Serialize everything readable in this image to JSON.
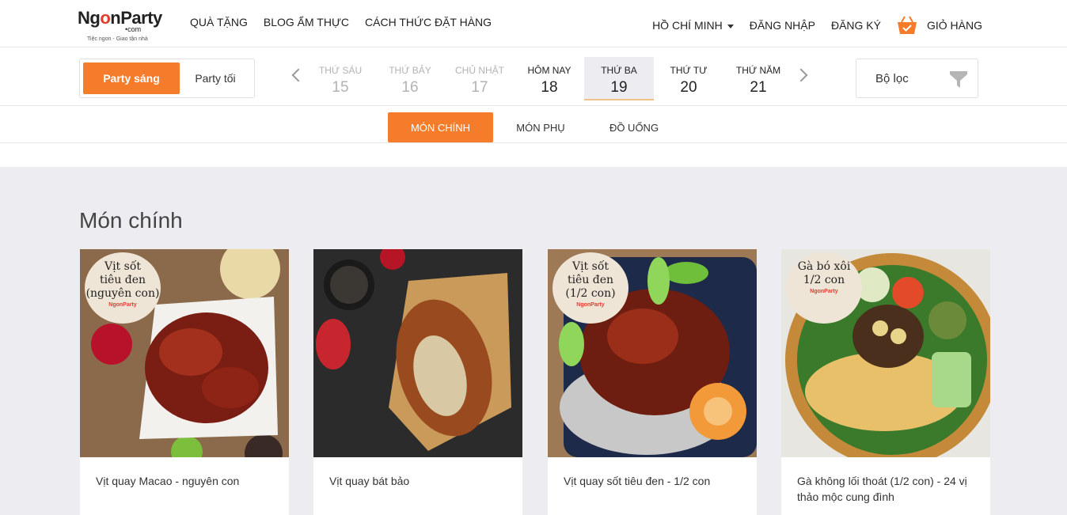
{
  "header": {
    "logo": {
      "brand_left": "Ng",
      "brand_o": "o",
      "brand_mid": "n",
      "brand_right": "Party",
      "dotcom": "•com",
      "tagline": "Tiệc ngon - Giao tận nhà"
    },
    "nav_left": [
      "QUÀ TẶNG",
      "BLOG ẨM THỰC",
      "CÁCH THỨC ĐẶT HÀNG"
    ],
    "city": "HỒ CHÍ MINH",
    "login": "ĐĂNG NHẬP",
    "register": "ĐĂNG KÝ",
    "cart": "GIỎ HÀNG"
  },
  "toolbar": {
    "party_morning": "Party sáng",
    "party_evening": "Party tối",
    "days": [
      {
        "name": "THỨ SÁU",
        "num": "15"
      },
      {
        "name": "THỨ BẢY",
        "num": "16"
      },
      {
        "name": "CHỦ NHẬT",
        "num": "17"
      },
      {
        "name": "HÔM NAY",
        "num": "18"
      },
      {
        "name": "THỨ BA",
        "num": "19"
      },
      {
        "name": "THỨ TƯ",
        "num": "20"
      },
      {
        "name": "THỨ NĂM",
        "num": "21"
      }
    ],
    "filter": "Bộ lọc"
  },
  "tabs": [
    "MÓN CHÍNH",
    "MÓN PHỤ",
    "ĐỒ UỐNG"
  ],
  "section_title": "Món chính",
  "cards": [
    {
      "name": "Vịt quay Macao - nguyên con",
      "badge": "Vịt sốt\ntiêu đen\n(nguyên con)",
      "badge_logo": "NgonParty"
    },
    {
      "name": "Vịt quay bát bảo"
    },
    {
      "name": "Vịt quay sốt tiêu đen - 1/2 con",
      "badge": "Vịt sốt\ntiêu đen\n(1/2 con)",
      "badge_logo": "NgonParty"
    },
    {
      "name": "Gà không lối thoát (1/2 con) - 24 vị thảo mộc cung đình",
      "badge": "Gà bó xôi\n1/2 con",
      "badge_logo": "NgonParty"
    }
  ],
  "colors": {
    "accent": "#f47c2a",
    "brand_red": "#e23b2e",
    "content_bg": "#ececf1"
  }
}
